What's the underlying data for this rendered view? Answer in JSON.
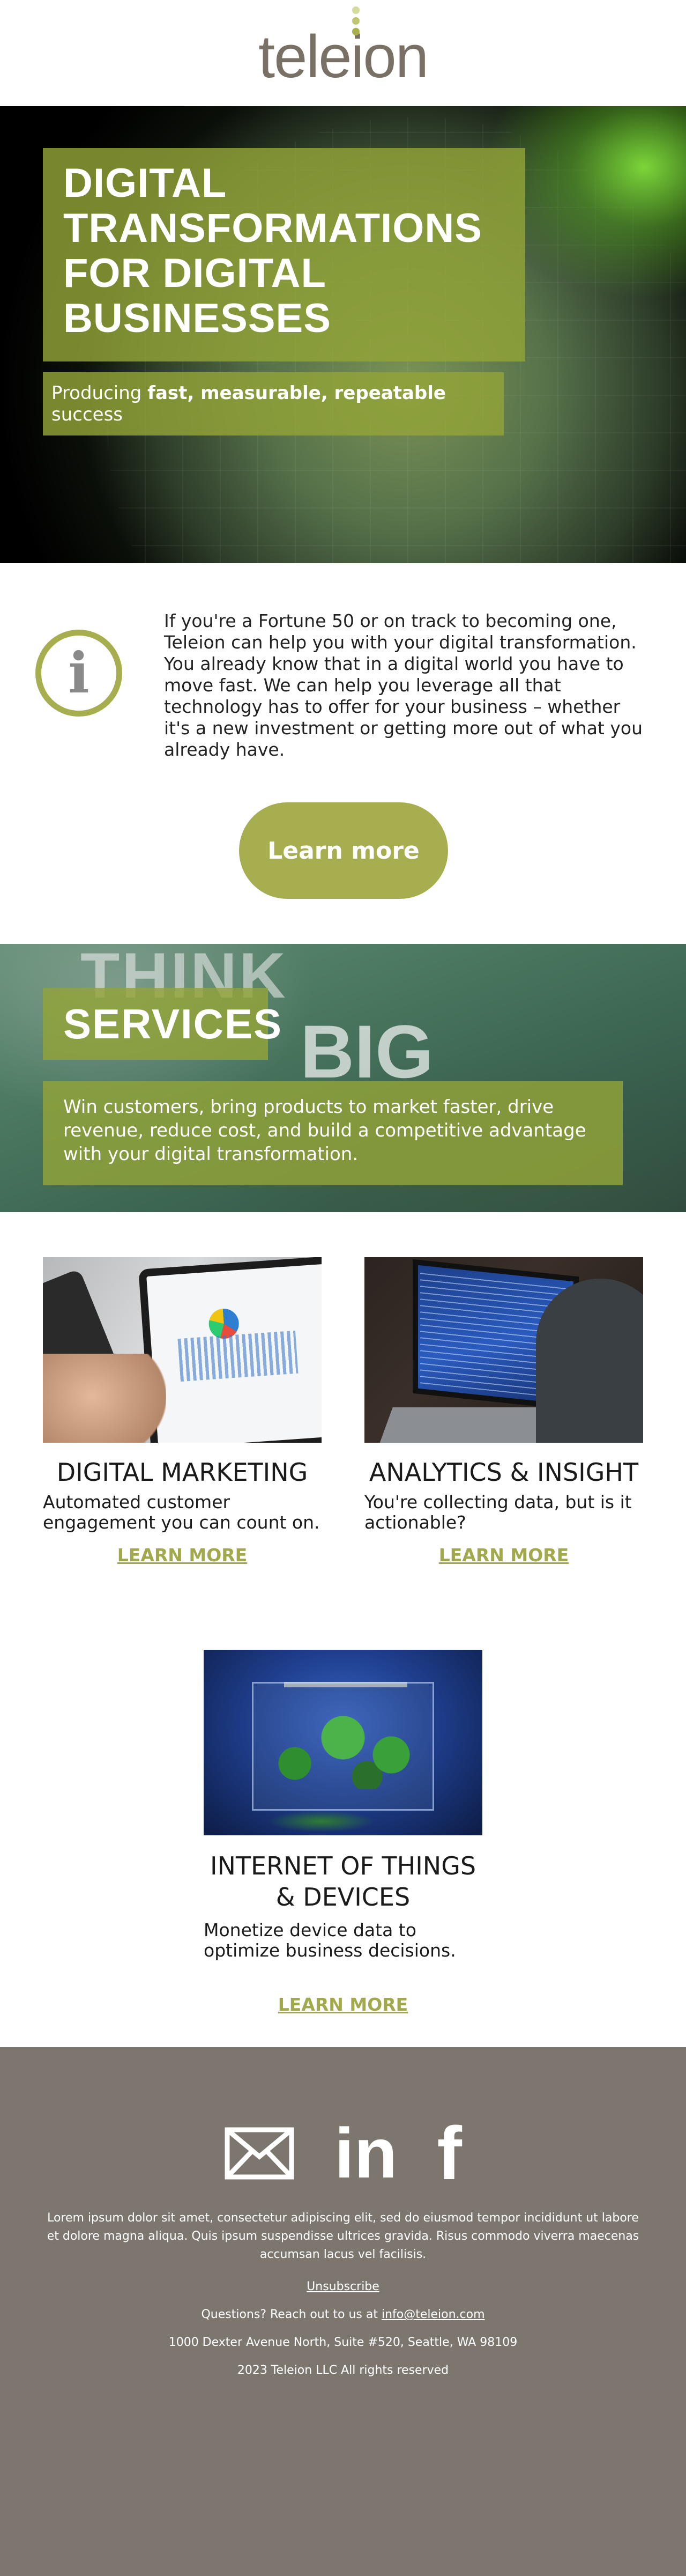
{
  "brand": {
    "logo_text": "teleion"
  },
  "hero": {
    "title": "DIGITAL TRANSFORMATIONS FOR DIGITAL BUSINESSES",
    "subtitle_prefix": "Producing ",
    "subtitle_bold": "fast, measurable, repeatable",
    "subtitle_suffix": " success"
  },
  "intro": {
    "icon": "info-icon",
    "text": "If you're a Fortune 50 or on track to becoming one, Teleion can help you with your digital transformation. You already know that in a digital world you have to move fast. We can help you leverage all that technology has to offer for your business – whether it's a new investment or getting more out of what you already have.",
    "button_label": "Learn more"
  },
  "services": {
    "title": "SERVICES",
    "description": "Win customers, bring products to market faster, drive revenue, reduce cost, and build a competitive advantage with your digital transformation."
  },
  "cards": [
    {
      "title": "DIGITAL MARKETING",
      "description": "Automated customer engagement you can count on.",
      "link": "LEARN MORE"
    },
    {
      "title": "ANALYTICS & INSIGHT",
      "description": "You're collecting data, but is it actionable?",
      "link": "LEARN MORE"
    },
    {
      "title": "INTERNET OF THINGS & DEVICES",
      "description": "Monetize device data to optimize business decisions.",
      "link": "LEARN MORE"
    }
  ],
  "footer": {
    "social_icons": [
      "mail-icon",
      "linkedin-icon",
      "facebook-icon"
    ],
    "linkedin_label": "in",
    "facebook_label": "f",
    "lorem": "Lorem ipsum dolor sit amet, consectetur adipiscing elit, sed do eiusmod tempor incididunt ut labore et dolore magna aliqua. Quis ipsum suspendisse ultrices gravida. Risus commodo viverra maecenas accumsan lacus vel facilisis.",
    "unsubscribe": "Unsubscribe",
    "questions_prefix": "Questions? Reach out to us at ",
    "email": "info@teleion.com",
    "address": "1000 Dexter Avenue North, Suite #520, Seattle, WA 98109",
    "copyright": "2023 Teleion LLC All rights reserved"
  },
  "colors": {
    "accent": "#a6ae50",
    "logo": "#7a7166",
    "footer_bg": "#7c766f"
  }
}
